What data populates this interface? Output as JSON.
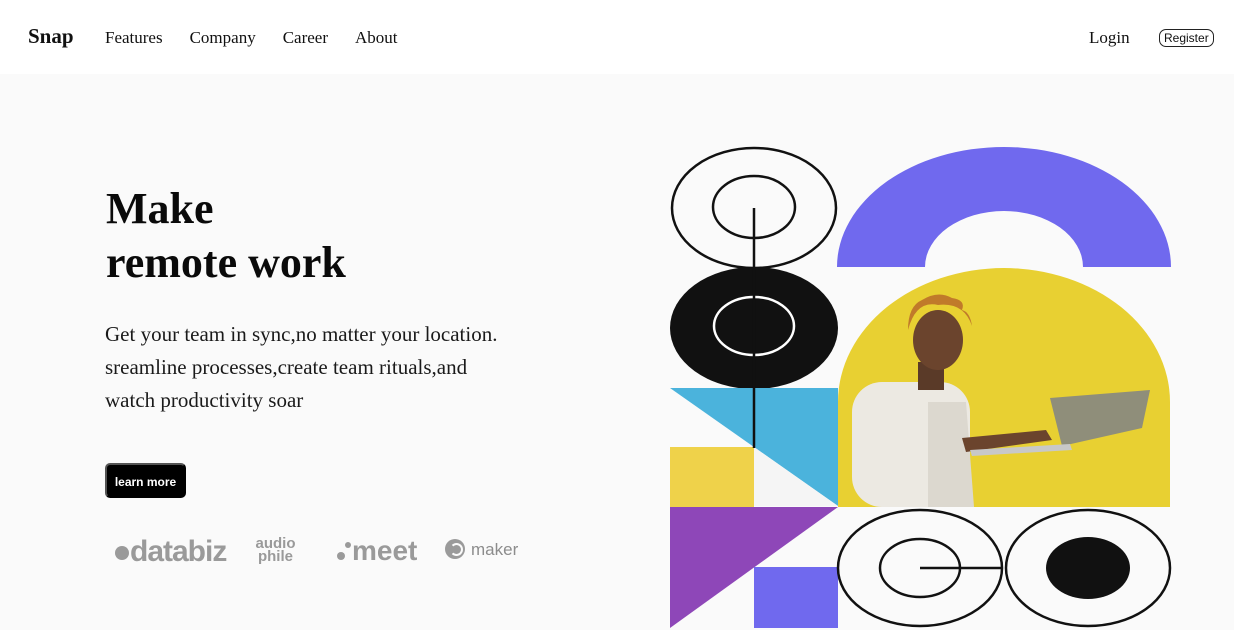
{
  "nav": {
    "logo": "Snap",
    "links": [
      "Features",
      "Company",
      "Career",
      "About"
    ],
    "login": "Login",
    "register": "Register"
  },
  "hero": {
    "headline_line1": "Make",
    "headline_line2": "remote work",
    "description_line1": "Get your team in sync,no matter your location.",
    "description_line2": "sreamline processes,create team rituals,and",
    "description_line3": "watch productivity soar",
    "cta": "learn more"
  },
  "brands": {
    "databiz": "databiz",
    "audiophile_line1": "audio",
    "audiophile_line2": "phile",
    "meet": "meet",
    "maker": "maker"
  },
  "colors": {
    "purple": "#7069ee",
    "yellow": "#e8d032",
    "blue": "#4bb3dc",
    "violet": "#8e47b8",
    "ink": "#111111"
  },
  "icons": {
    "brand_databiz": "databiz-logo",
    "brand_audiophile": "audiophile-logo",
    "brand_meet": "meet-logo",
    "brand_maker": "maker-logo"
  }
}
